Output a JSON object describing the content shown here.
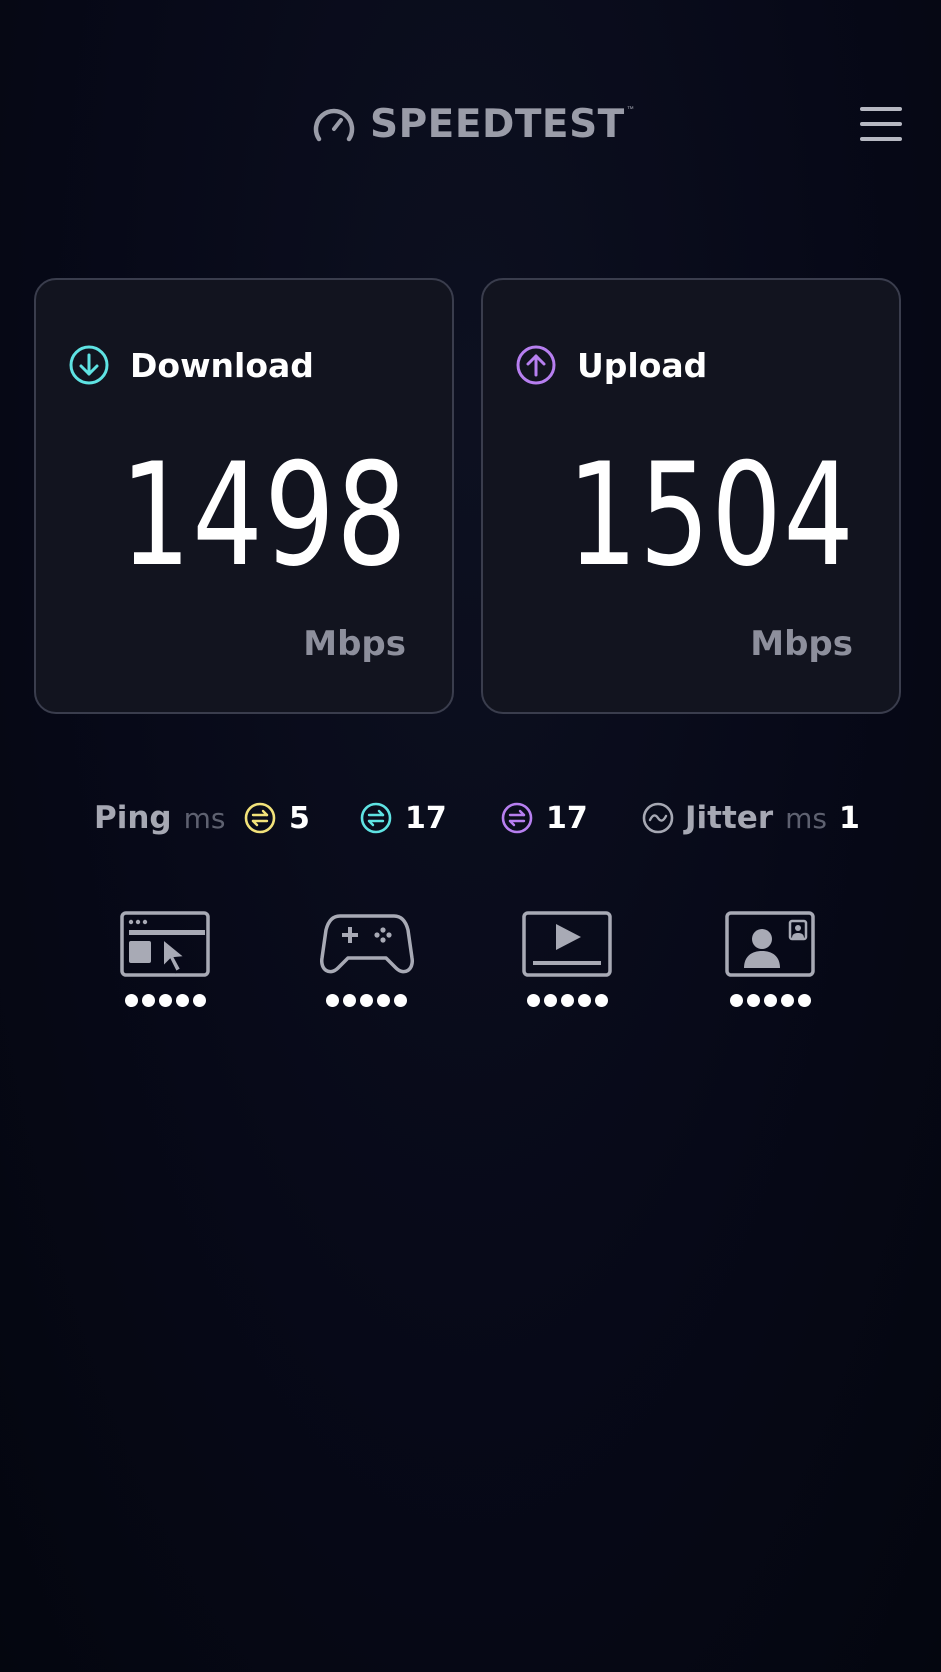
{
  "header": {
    "logo_text": "SPEEDTEST",
    "logo_icon": "speedometer-icon",
    "menu_icon": "hamburger-menu-icon"
  },
  "download": {
    "label": "Download",
    "value": "1498",
    "unit": "Mbps",
    "icon": "arrow-down-circle-icon",
    "accent": "#5fe3e3"
  },
  "upload": {
    "label": "Upload",
    "value": "1504",
    "unit": "Mbps",
    "icon": "arrow-up-circle-icon",
    "accent": "#b77ff0"
  },
  "ping": {
    "label": "Ping",
    "unit": "ms",
    "idle": {
      "value": "5",
      "icon": "idle-latency-icon",
      "color": "#f2e27a"
    },
    "download": {
      "value": "17",
      "icon": "download-latency-icon",
      "color": "#5fe3e3"
    },
    "upload": {
      "value": "17",
      "icon": "upload-latency-icon",
      "color": "#b77ff0"
    }
  },
  "jitter": {
    "label": "Jitter",
    "unit": "ms",
    "value": "1",
    "icon": "jitter-wave-icon"
  },
  "apps": [
    {
      "name": "web-browsing",
      "icon": "browser-cursor-icon",
      "rating": 5,
      "rating_max": 5
    },
    {
      "name": "gaming",
      "icon": "gamepad-icon",
      "rating": 5,
      "rating_max": 5
    },
    {
      "name": "video-streaming",
      "icon": "video-play-icon",
      "rating": 5,
      "rating_max": 5
    },
    {
      "name": "video-chat",
      "icon": "video-call-icon",
      "rating": 5,
      "rating_max": 5
    }
  ]
}
